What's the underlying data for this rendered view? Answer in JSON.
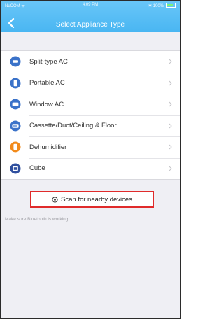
{
  "status_bar": {
    "carrier": "NuCOM ᯤ",
    "time": "4:09 PM",
    "battery": "✱ 100%"
  },
  "header": {
    "title": "Select Appliance Type",
    "back_icon": "chevron-left-icon"
  },
  "colors": {
    "header": "#55bbf4",
    "icon_blue": "#3a72c9",
    "icon_orange": "#f28a1a",
    "highlight_border": "#e02b2b"
  },
  "appliance_list": [
    {
      "label": "Split-type AC",
      "icon": "split-ac-icon",
      "chevron": ">"
    },
    {
      "label": "Portable AC",
      "icon": "portable-ac-icon",
      "chevron": ">"
    },
    {
      "label": "Window AC",
      "icon": "window-ac-icon",
      "chevron": ">"
    },
    {
      "label": "Cassette/Duct/Ceiling & Floor",
      "icon": "cassette-ac-icon",
      "chevron": ">"
    },
    {
      "label": "Dehumidifier",
      "icon": "dehumidifier-icon",
      "chevron": ">"
    },
    {
      "label": "Cube",
      "icon": "cube-icon",
      "chevron": ">"
    }
  ],
  "scan": {
    "label": "Scan for nearby devices",
    "icon": "scan-icon"
  },
  "hint": "Make sure Bluetooth is working."
}
